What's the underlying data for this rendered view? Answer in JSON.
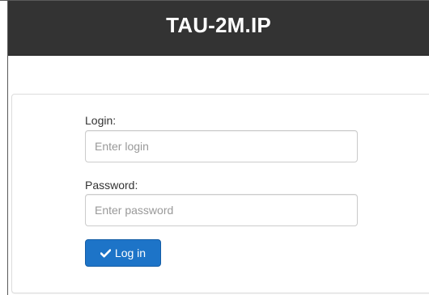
{
  "header": {
    "title": "TAU-2M.IP"
  },
  "form": {
    "login_label": "Login:",
    "login_placeholder": "Enter login",
    "login_value": "",
    "password_label": "Password:",
    "password_placeholder": "Enter password",
    "password_value": "",
    "submit_label": "Log in",
    "submit_icon": "check-icon"
  },
  "colors": {
    "header_bg": "#333333",
    "header_text": "#ffffff",
    "button_bg": "#1d74c8"
  }
}
